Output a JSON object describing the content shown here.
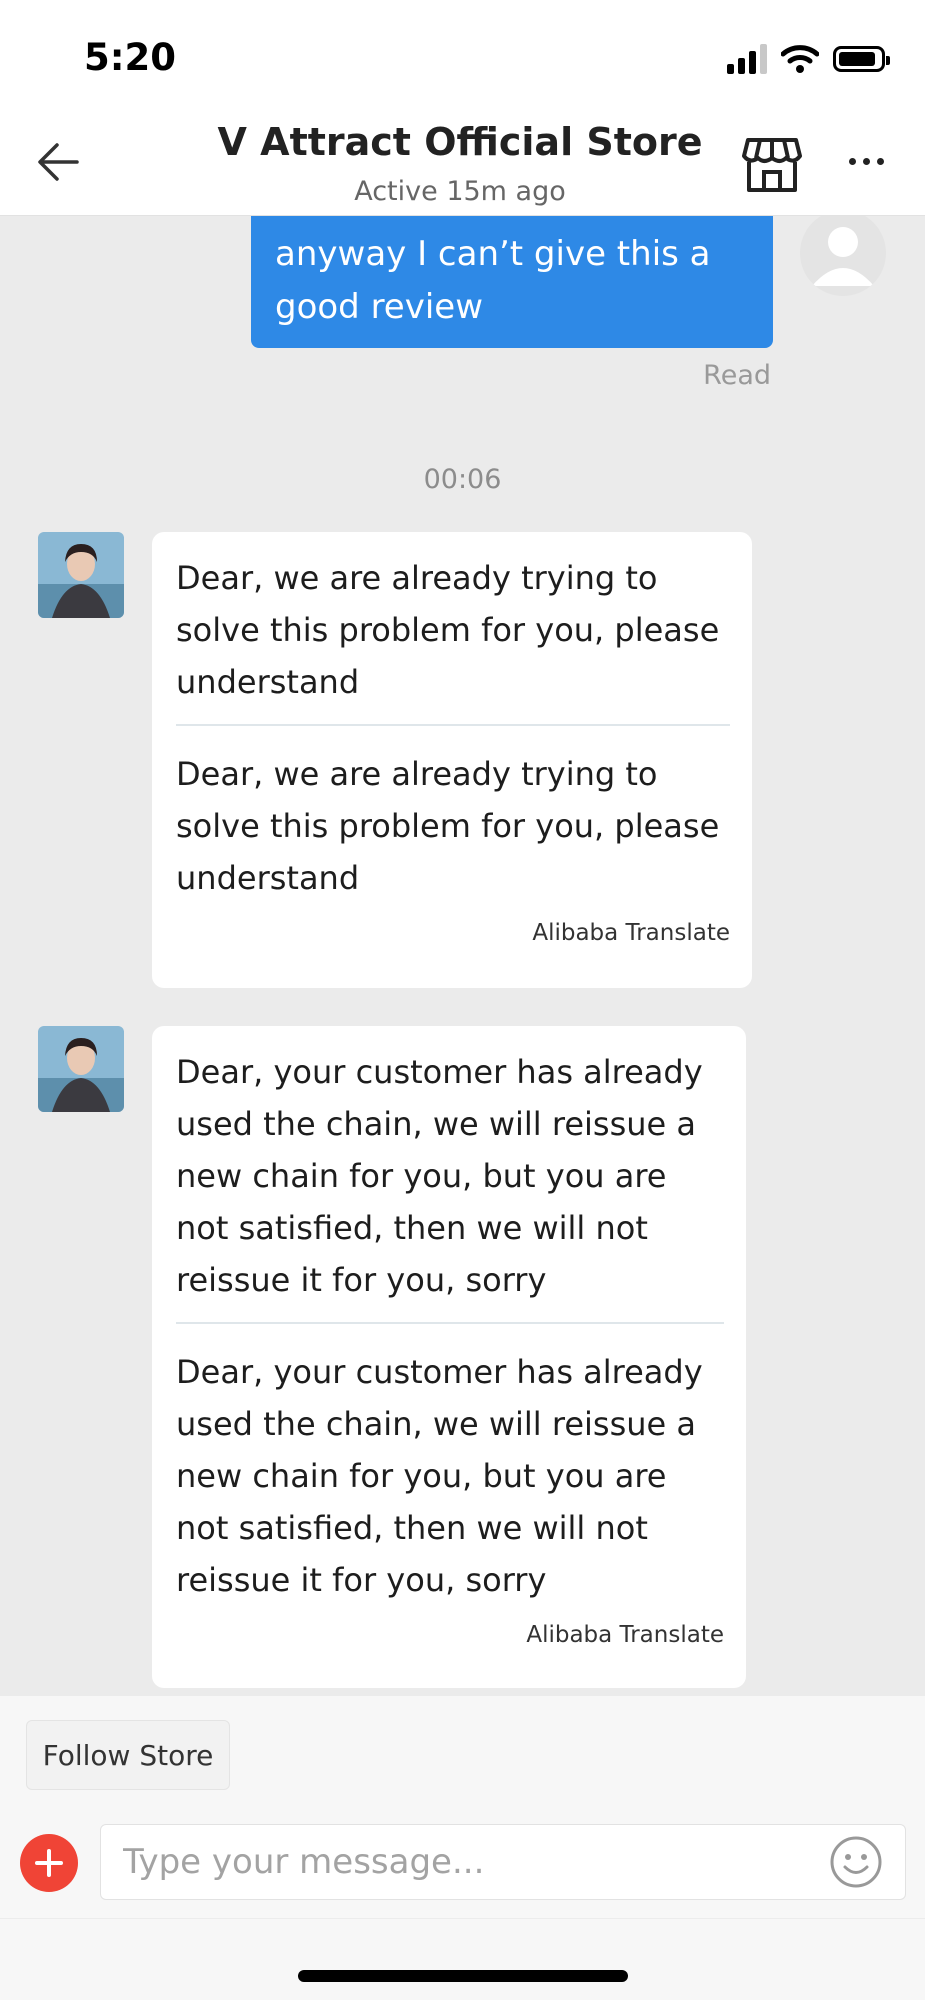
{
  "status_bar": {
    "time": "5:20"
  },
  "header": {
    "title": "V Attract Official Store",
    "subtitle": "Active 15m ago"
  },
  "messages": {
    "outgoing": {
      "text": "anyway I can’t give this a good review",
      "status": "Read"
    },
    "timestamp": "00:06",
    "incoming": [
      {
        "original": "Dear, we are already trying to solve this problem for you, please understand",
        "translated": "Dear, we are already trying to solve this problem for you, please understand",
        "translator": "Alibaba Translate"
      },
      {
        "original": "Dear, your customer has already used the chain, we will reissue a new chain for you, but you are not satisfied, then we will not reissue it for you, sorry",
        "translated": "Dear, your customer has already used the chain, we will reissue a new chain for you, but you are not satisfied, then we will not reissue it for you, sorry",
        "translator": "Alibaba Translate"
      }
    ]
  },
  "bottom": {
    "follow_label": "Follow Store",
    "input_placeholder": "Type your message..."
  },
  "colors": {
    "accent_blue": "#2e89e6",
    "chat_background": "#ebebeb",
    "plus_red": "#f04436"
  },
  "icons": [
    "back-arrow-icon",
    "store-icon",
    "more-icon",
    "plus-icon",
    "emoji-icon",
    "wifi-icon",
    "signal-icon",
    "battery-icon"
  ]
}
